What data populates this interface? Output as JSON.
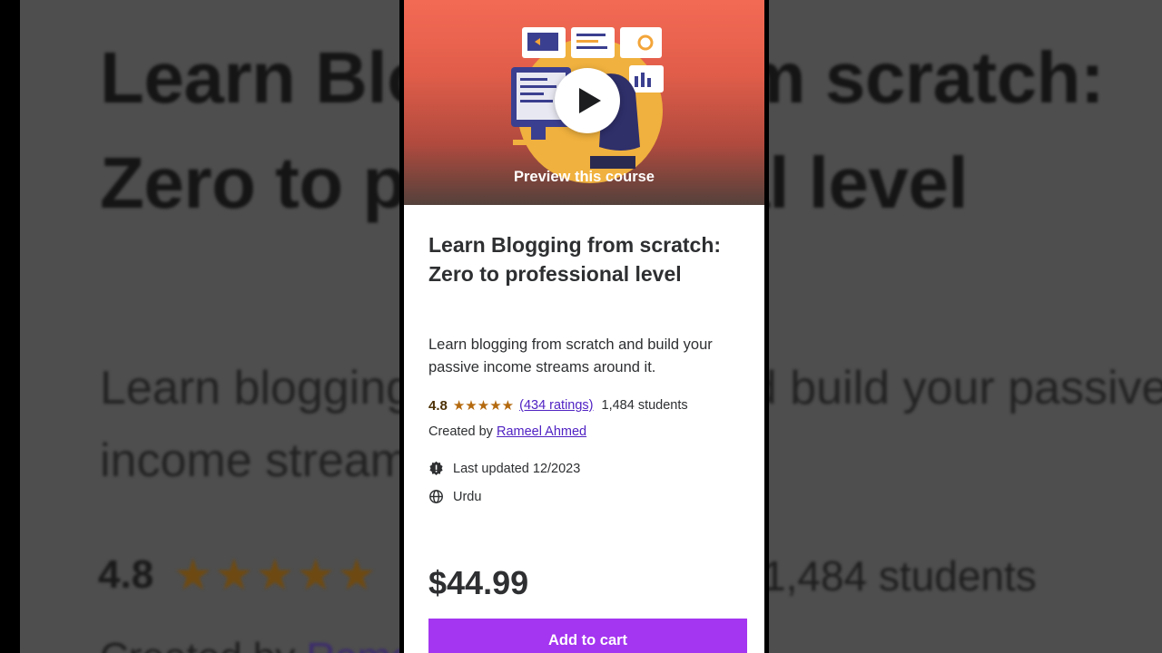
{
  "background": {
    "title": "Learn Blogging from scratch: Zero to professional level",
    "subtitle": "Learn blogging from scratch and build your passive income streams around it.",
    "rating_value": "4.8",
    "stars": "★★★★★",
    "students": "1,484 students",
    "created_by_prefix": "Created by ",
    "instructor": "Rameel Ahmed"
  },
  "preview": {
    "label": "Preview this course",
    "icon": "play-icon"
  },
  "course": {
    "title": "Learn Blogging from scratch: Zero to professional level",
    "description": "Learn blogging from scratch and build your passive income streams around it.",
    "rating_value": "4.8",
    "stars": "★★★★★",
    "ratings_count": "(434 ratings)",
    "students": "1,484 students",
    "created_by_label": "Created by",
    "instructor": "Rameel Ahmed",
    "last_updated": "Last updated 12/2023",
    "language": "Urdu",
    "price": "$44.99",
    "add_to_cart": "Add to cart"
  },
  "colors": {
    "accent": "#a435f0",
    "link": "#5022c3",
    "star": "#b4690e",
    "preview_gradient_top": "#f36a54"
  }
}
